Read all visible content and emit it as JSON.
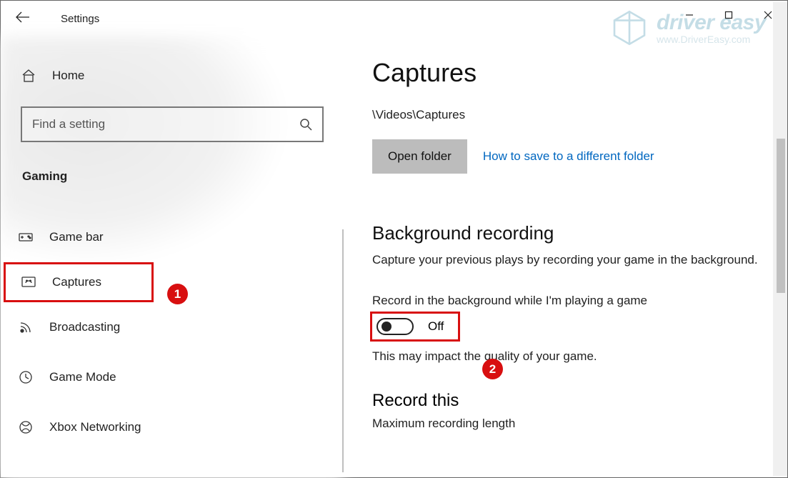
{
  "header": {
    "app_title": "Settings"
  },
  "sidebar": {
    "home_label": "Home",
    "search_placeholder": "Find a setting",
    "category": "Gaming",
    "items": [
      {
        "label": "Game bar"
      },
      {
        "label": "Captures"
      },
      {
        "label": "Broadcasting"
      },
      {
        "label": "Game Mode"
      },
      {
        "label": "Xbox Networking"
      }
    ]
  },
  "main": {
    "title": "Captures",
    "path": "\\Videos\\Captures",
    "open_folder": "Open folder",
    "how_to_link": "How to save to a different folder",
    "bg_heading": "Background recording",
    "bg_desc": "Capture your previous plays by recording your game in the background.",
    "record_label": "Record in the background while I'm playing a game",
    "toggle_state": "Off",
    "toggle_note": "This may impact the quality of your game.",
    "record_this": "Record this",
    "max_len": "Maximum recording length"
  },
  "annotations": {
    "badge1": "1",
    "badge2": "2"
  },
  "watermark": {
    "brand": "driver easy",
    "url": "www.DriverEasy.com"
  }
}
